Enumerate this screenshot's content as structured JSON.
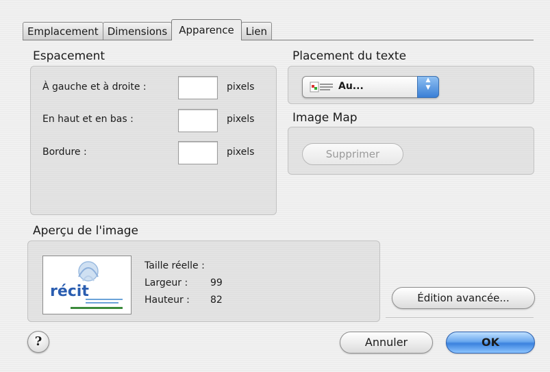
{
  "tabs": [
    {
      "label": "Emplacement",
      "active": false
    },
    {
      "label": "Dimensions",
      "active": false
    },
    {
      "label": "Apparence",
      "active": true
    },
    {
      "label": "Lien",
      "active": false
    }
  ],
  "spacing": {
    "title": "Espacement",
    "rows": [
      {
        "label": "À gauche et à droite :",
        "value": "",
        "unit": "pixels"
      },
      {
        "label": "En haut et en bas :",
        "value": "",
        "unit": "pixels"
      },
      {
        "label": "Bordure :",
        "value": "",
        "unit": "pixels"
      }
    ]
  },
  "text_placement": {
    "title": "Placement du texte",
    "selected": "Au...",
    "icon": "text-wrap-icon"
  },
  "image_map": {
    "title": "Image Map",
    "delete_label": "Supprimer"
  },
  "preview": {
    "title": "Aperçu de l'image",
    "thumbnail_text": "récit",
    "actual_size_label": "Taille réelle :",
    "width_label": "Largeur :",
    "width_value": "99",
    "height_label": "Hauteur :",
    "height_value": "82"
  },
  "buttons": {
    "help": "?",
    "advanced": "Édition avancée...",
    "cancel": "Annuler",
    "ok": "OK"
  },
  "colors": {
    "accent": "#3b82de",
    "window": "#ededed"
  }
}
